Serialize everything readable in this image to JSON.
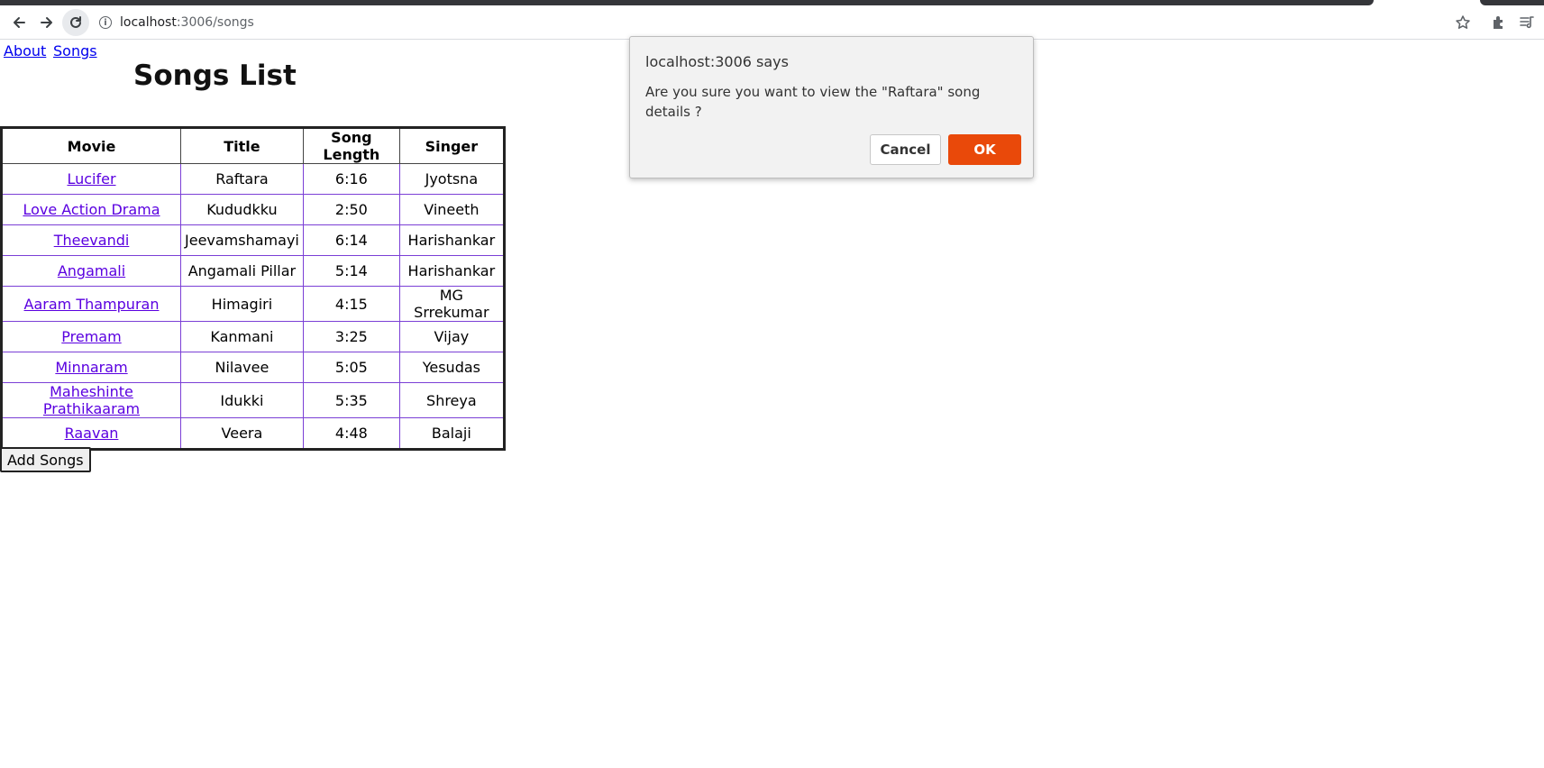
{
  "browser": {
    "url_host": "localhost",
    "url_path": ":3006/songs",
    "icons": [
      "back-arrow-icon",
      "forward-arrow-icon",
      "reload-icon",
      "site-info-icon",
      "bookmark-star-icon",
      "extensions-puzzle-icon",
      "media-queue-icon"
    ]
  },
  "nav": {
    "about": "About",
    "songs": "Songs"
  },
  "page_title": "Songs List",
  "table": {
    "headers": [
      "Movie",
      "Title",
      "Song Length",
      "Singer"
    ],
    "rows": [
      {
        "movie": "Lucifer",
        "title": "Raftara",
        "length": "6:16",
        "singer": "Jyotsna"
      },
      {
        "movie": "Love Action Drama",
        "title": "Kududkku",
        "length": "2:50",
        "singer": "Vineeth"
      },
      {
        "movie": "Theevandi",
        "title": "Jeevamshamayi",
        "length": "6:14",
        "singer": "Harishankar"
      },
      {
        "movie": "Angamali",
        "title": "Angamali Pillar",
        "length": "5:14",
        "singer": "Harishankar"
      },
      {
        "movie": "Aaram Thampuran",
        "title": "Himagiri",
        "length": "4:15",
        "singer": "MG Srrekumar"
      },
      {
        "movie": "Premam",
        "title": "Kanmani",
        "length": "3:25",
        "singer": "Vijay"
      },
      {
        "movie": "Minnaram",
        "title": "Nilavee",
        "length": "5:05",
        "singer": "Yesudas"
      },
      {
        "movie": "Maheshinte Prathikaaram",
        "title": "Idukki",
        "length": "5:35",
        "singer": "Shreya"
      },
      {
        "movie": "Raavan",
        "title": "Veera",
        "length": "4:48",
        "singer": "Balaji"
      }
    ]
  },
  "add_button": "Add Songs",
  "dialog": {
    "title": "localhost:3006 says",
    "message": "Are you sure you want to view the \"Raftara\" song details ?",
    "cancel": "Cancel",
    "ok": "OK"
  },
  "colors": {
    "link": "#0000ee",
    "table_link": "#5a00e0",
    "ok_button": "#e9490a"
  }
}
